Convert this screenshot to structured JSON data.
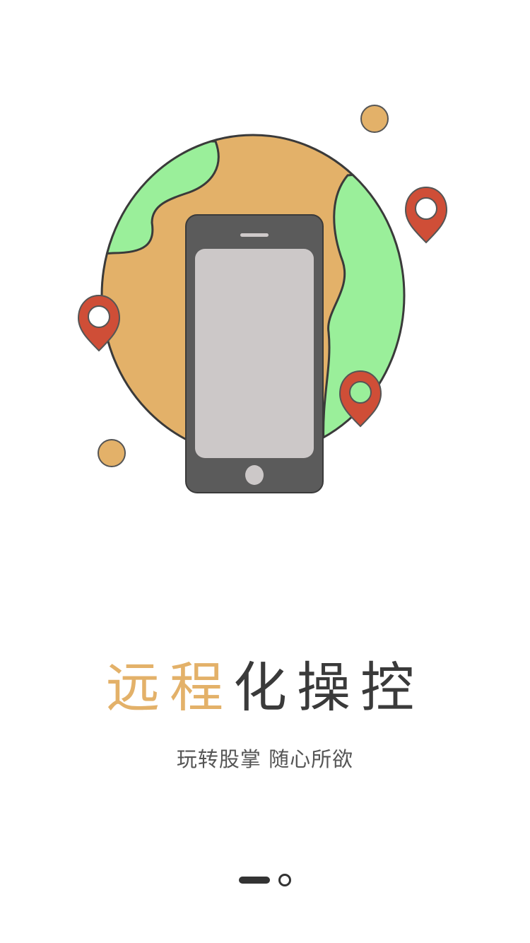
{
  "title": {
    "accent_text": "远程",
    "rest_text": "化操控"
  },
  "subtitle": "玩转股掌  随心所欲",
  "pager": {
    "count": 2,
    "active_index": 0
  },
  "colors": {
    "accent": "#e3b169",
    "globe_land": "#9aef9a",
    "globe_ocean": "#e3b169",
    "pin": "#cf4e37",
    "phone_body": "#5b5b5b",
    "phone_screen": "#ccc8c8"
  },
  "icons": {
    "globe": "globe-icon",
    "phone": "smartphone-icon",
    "pin": "location-pin-icon"
  }
}
